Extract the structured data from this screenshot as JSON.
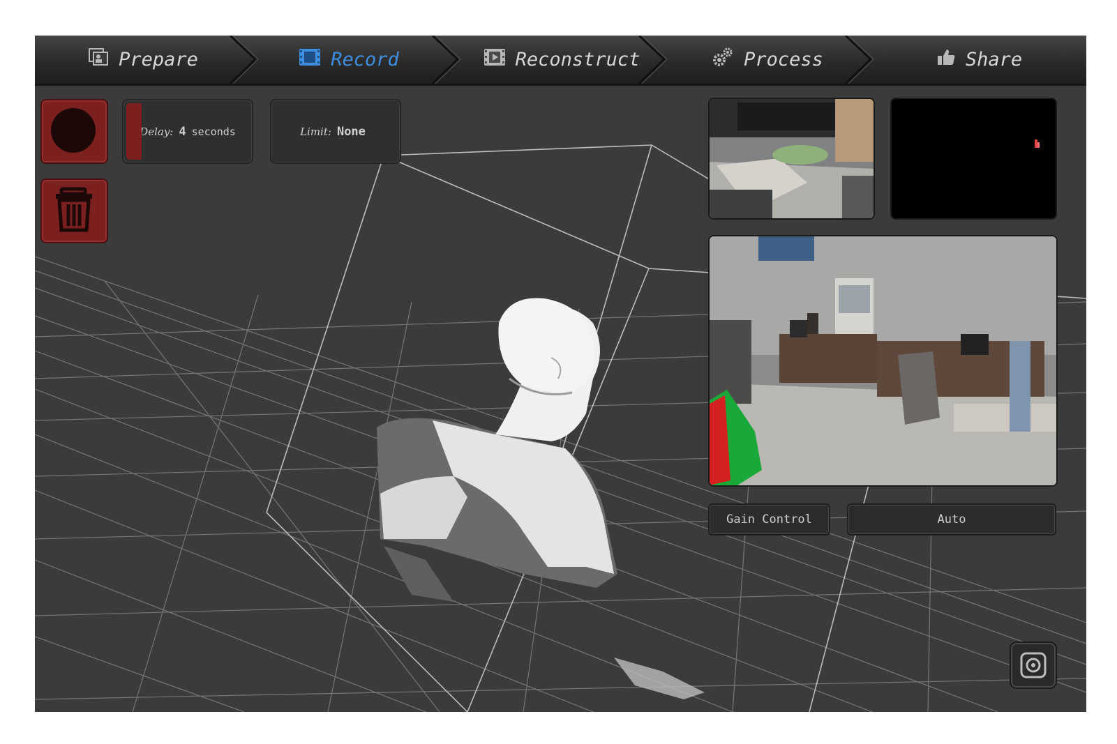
{
  "nav": {
    "steps": [
      {
        "label": "Prepare",
        "icon": "photos-icon",
        "active": false
      },
      {
        "label": "Record",
        "icon": "film-frame-icon",
        "active": true
      },
      {
        "label": "Reconstruct",
        "icon": "film-strip-icon",
        "active": false
      },
      {
        "label": "Process",
        "icon": "gears-icon",
        "active": false
      },
      {
        "label": "Share",
        "icon": "thumbs-up-icon",
        "active": false
      }
    ]
  },
  "controls": {
    "record_icon": "record-icon",
    "delete_icon": "trash-icon",
    "delay_label": "Delay:",
    "delay_value": "4",
    "delay_unit": "seconds",
    "limit_label": "Limit:",
    "limit_value": "None"
  },
  "gain": {
    "label": "Gain Control",
    "value": "Auto"
  },
  "snapshot_icon": "camera-lens-icon",
  "colors": {
    "accent_blue": "#3f8fe0",
    "record_red": "#7c1f1f",
    "background": "#3b3b3b"
  }
}
